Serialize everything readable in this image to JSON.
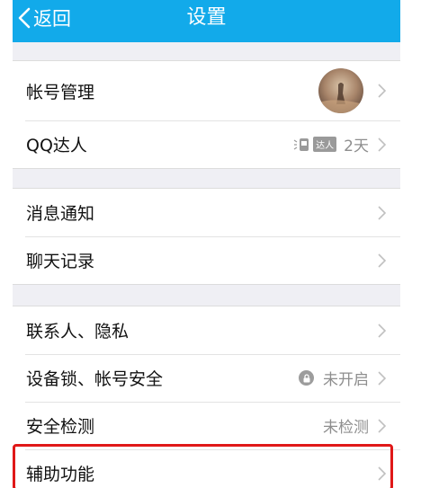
{
  "navbar": {
    "back_label": "返回",
    "title": "设置"
  },
  "account_group": {
    "account": {
      "label": "帐号管理"
    },
    "qq_daren": {
      "label": "QQ达人",
      "badge": "达人",
      "value": "2天"
    }
  },
  "notify_group": {
    "messages": {
      "label": "消息通知"
    },
    "chat_history": {
      "label": "聊天记录"
    }
  },
  "security_group": {
    "contacts_privacy": {
      "label": "联系人、隐私"
    },
    "device_lock": {
      "label": "设备锁、帐号安全",
      "status": "未开启"
    },
    "security_scan": {
      "label": "安全检测",
      "status": "未检测"
    },
    "accessibility": {
      "label": "辅助功能"
    }
  },
  "colors": {
    "navbar": "#12aaea",
    "highlight": "#e01818",
    "background": "#efeff4"
  },
  "icons": [
    "back-chevron-icon",
    "chevron-right-icon",
    "lock-icon",
    "qq-daren-badge-icon",
    "avatar"
  ]
}
